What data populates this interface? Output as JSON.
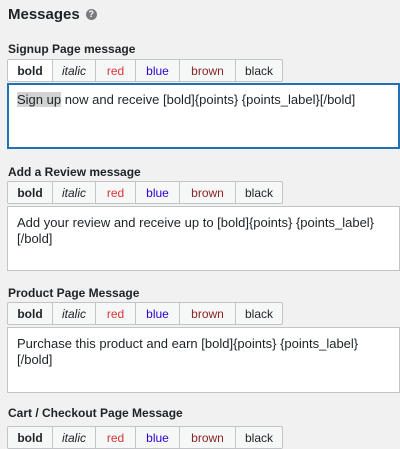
{
  "section": {
    "title": "Messages",
    "help_icon": "?"
  },
  "toolbar_buttons": {
    "bold": "bold",
    "italic": "italic",
    "red": "red",
    "blue": "blue",
    "brown": "brown",
    "black": "black"
  },
  "colors": {
    "red": "#d63638",
    "blue": "#2e00d6",
    "brown": "#8a2424",
    "black": "#1d2327",
    "focus": "#2271b1"
  },
  "messages": [
    {
      "label": "Signup Page message",
      "selected_text": "Sign up",
      "text": " now and receive [bold]{points} {points_label}[/bold]"
    },
    {
      "label": "Add a Review message",
      "text": "Add your review and receive up to [bold]{points} {points_label}[/bold]"
    },
    {
      "label": "Product Page Message",
      "text": "Purchase this product and earn [bold]{points} {points_label}[/bold]"
    },
    {
      "label": "Cart / Checkout Page Message"
    }
  ]
}
